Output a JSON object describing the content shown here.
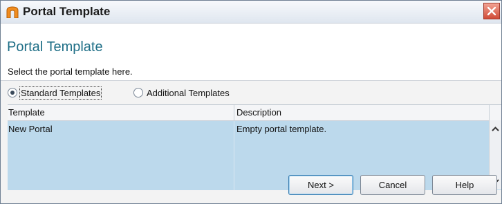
{
  "window": {
    "title": "Portal Template"
  },
  "header": {
    "heading": "Portal Template",
    "subtitle": "Select the portal template here."
  },
  "radios": [
    {
      "label": "Standard Templates",
      "selected": true
    },
    {
      "label": "Additional Templates",
      "selected": false
    }
  ],
  "table": {
    "columns": [
      "Template",
      "Description"
    ],
    "rows": [
      {
        "template": "New Portal",
        "description": "Empty portal template."
      }
    ],
    "selected_row_color": "#bcd9ec"
  },
  "buttons": {
    "next": "Next >",
    "cancel": "Cancel",
    "help": "Help"
  },
  "icons": {
    "title": "portal-arch-icon",
    "close": "close-icon",
    "scroll_up": "chevron-up-icon",
    "scroll_down": "chevron-down-icon"
  },
  "colors": {
    "heading": "#1f6f87",
    "close": "#d04b37",
    "accent": "#3c7fb1"
  }
}
